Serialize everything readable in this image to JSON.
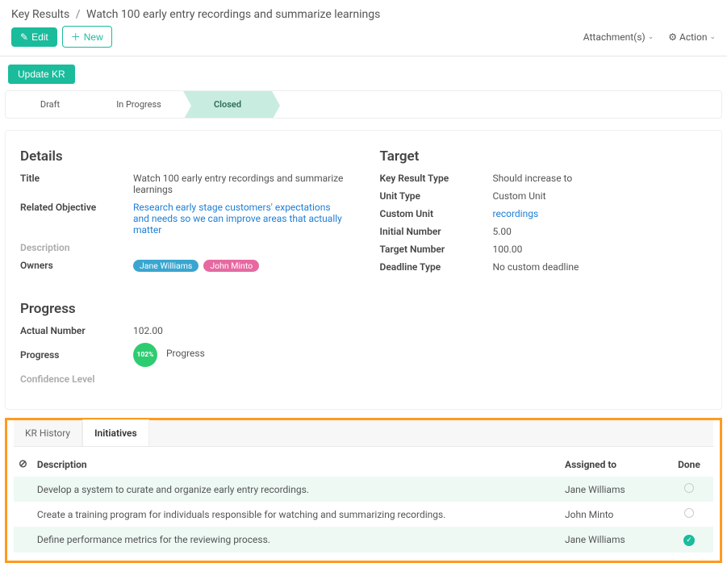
{
  "breadcrumb": {
    "root": "Key Results",
    "sep": "/",
    "current": "Watch 100 early entry recordings and summarize learnings"
  },
  "toolbar": {
    "edit_label": "Edit",
    "new_label": "New",
    "attachments_label": "Attachment(s)",
    "action_label": "Action"
  },
  "update_button": "Update KR",
  "stages": {
    "draft": "Draft",
    "in_progress": "In Progress",
    "closed": "Closed"
  },
  "details": {
    "heading": "Details",
    "title_label": "Title",
    "title_value": "Watch 100 early entry recordings and summarize learnings",
    "related_label": "Related Objective",
    "related_value": "Research early stage customers' expectations and needs so we can improve areas that actually matter",
    "description_label": "Description",
    "owners_label": "Owners",
    "owners": [
      "Jane Williams",
      "John Minto"
    ]
  },
  "target": {
    "heading": "Target",
    "type_label": "Key Result Type",
    "type_value": "Should increase to",
    "unit_type_label": "Unit Type",
    "unit_type_value": "Custom Unit",
    "custom_unit_label": "Custom Unit",
    "custom_unit_value": "recordings",
    "initial_label": "Initial Number",
    "initial_value": "5.00",
    "target_label": "Target Number",
    "target_value": "100.00",
    "deadline_label": "Deadline Type",
    "deadline_value": "No custom deadline"
  },
  "progress": {
    "heading": "Progress",
    "actual_label": "Actual Number",
    "actual_value": "102.00",
    "progress_label": "Progress",
    "badge_text": "102%",
    "progress_word": "Progress",
    "confidence_label": "Confidence Level"
  },
  "tabs": {
    "history": "KR History",
    "initiatives": "Initiatives"
  },
  "initiatives_table": {
    "col_description": "Description",
    "col_assigned": "Assigned to",
    "col_done": "Done",
    "rows": [
      {
        "desc": "Develop a system to curate and organize early entry recordings.",
        "assigned": "Jane Williams",
        "done": false
      },
      {
        "desc": "Create a training program for individuals responsible for watching and summarizing recordings.",
        "assigned": "John Minto",
        "done": false
      },
      {
        "desc": "Define performance metrics for the reviewing process.",
        "assigned": "Jane Williams",
        "done": true
      }
    ]
  }
}
